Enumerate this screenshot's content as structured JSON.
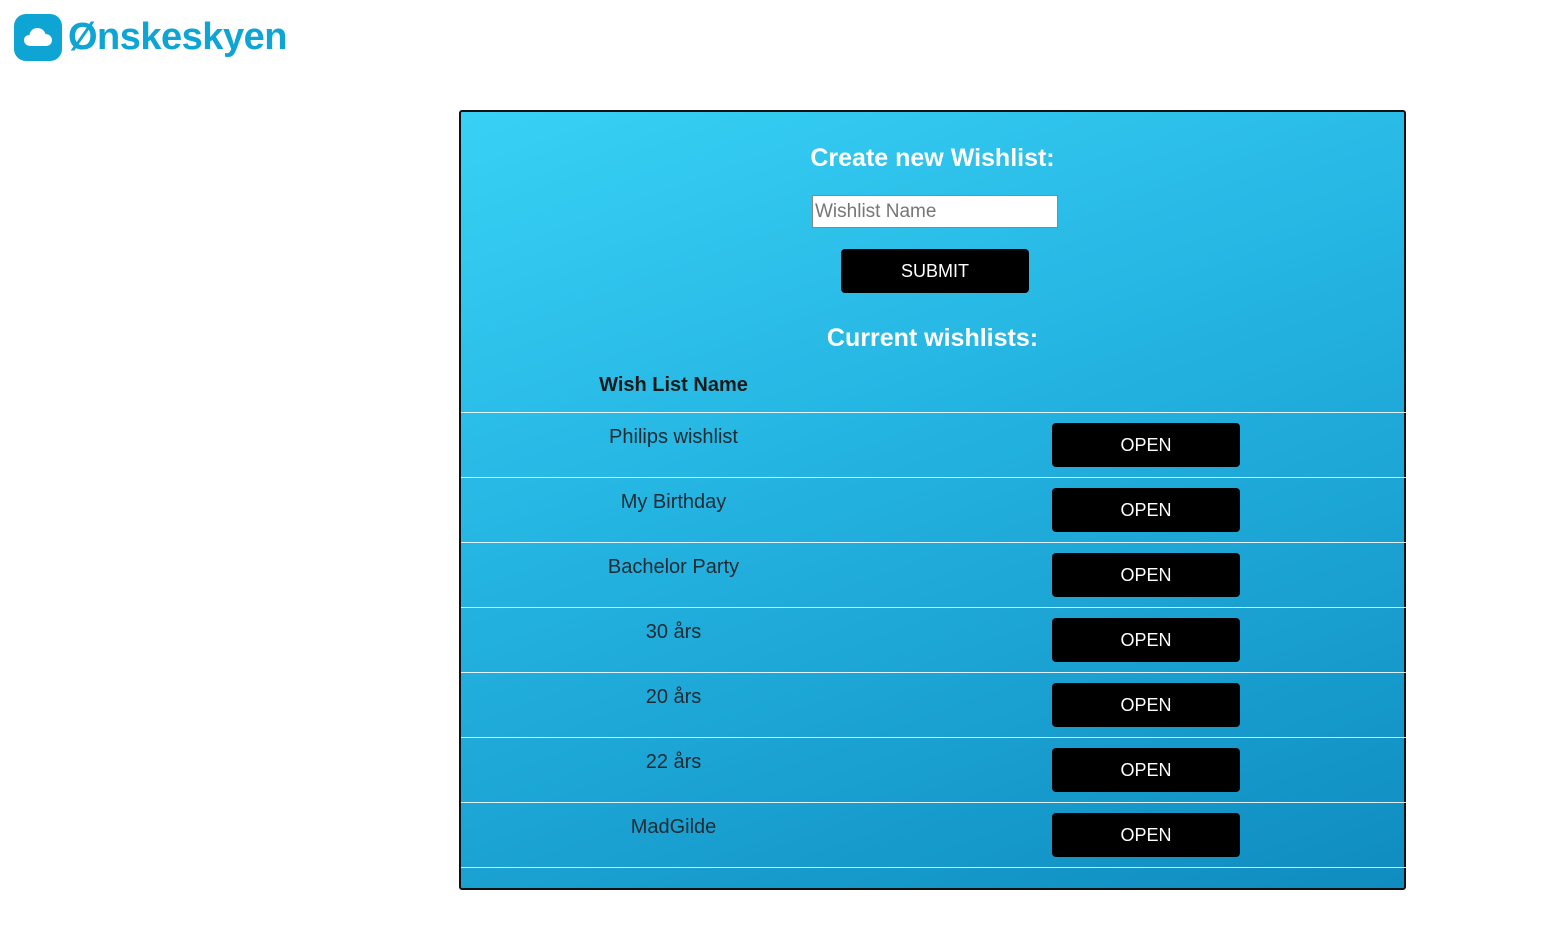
{
  "brand": {
    "name": "Ønskeskyen",
    "icon": "cloud-icon",
    "color": "#0ea5d4"
  },
  "create": {
    "title": "Create new Wishlist:",
    "input_placeholder": "Wishlist Name",
    "input_value": "",
    "submit_label": "SUBMIT"
  },
  "current": {
    "title": "Current wishlists:",
    "column_header": "Wish List Name",
    "open_label": "OPEN",
    "wishlists": [
      {
        "name": "Philips wishlist"
      },
      {
        "name": "My Birthday"
      },
      {
        "name": "Bachelor Party"
      },
      {
        "name": "30 års"
      },
      {
        "name": "20 års"
      },
      {
        "name": "22 års"
      },
      {
        "name": "MadGilde"
      }
    ]
  }
}
